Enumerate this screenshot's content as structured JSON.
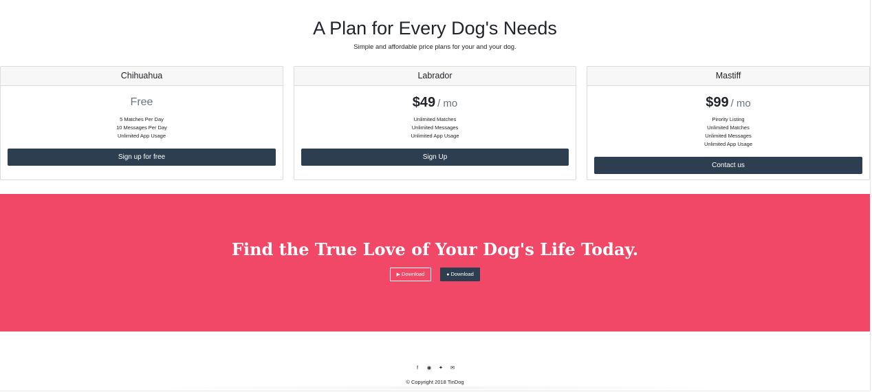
{
  "pricing": {
    "title": "A Plan for Every Dog's Needs",
    "subtitle": "Simple and affordable price plans for your and your dog.",
    "plans": [
      {
        "name": "Chihuahua",
        "price": "Free",
        "period": "",
        "features": [
          "5 Matches Per Day",
          "10 Messages Per Day",
          "Unlimited App Usage"
        ],
        "button_label": "Sign up for free"
      },
      {
        "name": "Labrador",
        "price": "$49",
        "period": "/ mo",
        "features": [
          "Unlimited Matches",
          "Unlimited Messages",
          "Unlimited App Usage"
        ],
        "button_label": "Sign Up"
      },
      {
        "name": "Mastiff",
        "price": "$99",
        "period": "/ mo",
        "features": [
          "Pirority Listing",
          "Unlimited Matches",
          "Unlimited Messages",
          "Unlimited App Usage"
        ],
        "button_label": "Contact us"
      }
    ]
  },
  "cta": {
    "title": "Find the True Love of Your Dog's Life Today.",
    "buttons": [
      {
        "label": "Download",
        "icon": "google-play-icon",
        "style": "outline"
      },
      {
        "label": "Download",
        "icon": "apple-icon",
        "style": "dark"
      }
    ]
  },
  "footer": {
    "social_icons": [
      "facebook-icon",
      "instagram-icon",
      "twitter-icon",
      "envelope-icon"
    ],
    "copyright": "© Copyright 2018 TinDog"
  },
  "colors": {
    "accent": "#f04866",
    "button_dark": "#2c3e50",
    "card_header_bg": "#f7f7f7"
  }
}
